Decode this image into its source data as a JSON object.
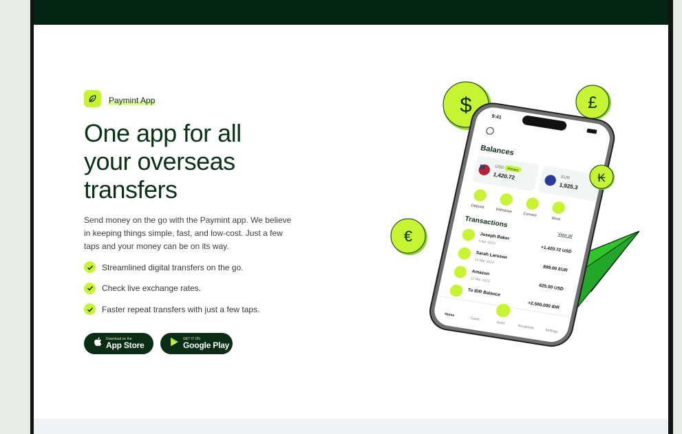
{
  "badge": {
    "label": "Paymint App"
  },
  "hero": {
    "headline": "One app for all your overseas transfers",
    "description": "Send money on the go with the Paymint app. We believe in keeping things simple, fast, and low-cost. Just a few taps and your money can be on its way."
  },
  "features": [
    {
      "text": "Streamlined digital transfers on the go."
    },
    {
      "text": "Check live exchange rates."
    },
    {
      "text": "Faster repeat transfers with just a few taps."
    }
  ],
  "store_buttons": {
    "apple": {
      "small": "Download on the",
      "big": "App Store"
    },
    "google": {
      "small": "GET IT ON",
      "big": "Google Play"
    }
  },
  "phone": {
    "time": "9:41",
    "balances_title": "Balances",
    "balances": [
      {
        "currency": "USD",
        "tag": "Primary",
        "amount": "1,420.72"
      },
      {
        "currency": "EUR",
        "amount": "1,925.3"
      }
    ],
    "actions": [
      "Deposit",
      "Withdraw",
      "Convert",
      "More"
    ],
    "transactions_title": "Transactions",
    "view_all": "View all",
    "transactions": [
      {
        "name": "Joseph Baker",
        "date": "4 Apr 2023",
        "amount": "+1,420.72 USD"
      },
      {
        "name": "Sarah Larsson",
        "date": "15 Mar 2023",
        "amount": "899.00 EUR"
      },
      {
        "name": "Amazon",
        "date": "12 Mar 2023",
        "amount": "625.00 USD"
      },
      {
        "name": "To IDR Balance",
        "date": "",
        "amount": "+2,500,000 IDR"
      }
    ],
    "nav": [
      "Home",
      "Cards",
      "Send",
      "Recipients",
      "Settings"
    ]
  },
  "coins": [
    {
      "symbol": "$"
    },
    {
      "symbol": "£"
    },
    {
      "symbol": "€"
    },
    {
      "symbol": "₭"
    }
  ],
  "colors": {
    "brand_dark": "#032313",
    "accent_lime": "#c6f432",
    "text_dark": "#0a3216"
  },
  "icons": {
    "badge": "leaf-icon",
    "check": "check-icon",
    "apple": "apple-icon",
    "google": "play-icon"
  }
}
